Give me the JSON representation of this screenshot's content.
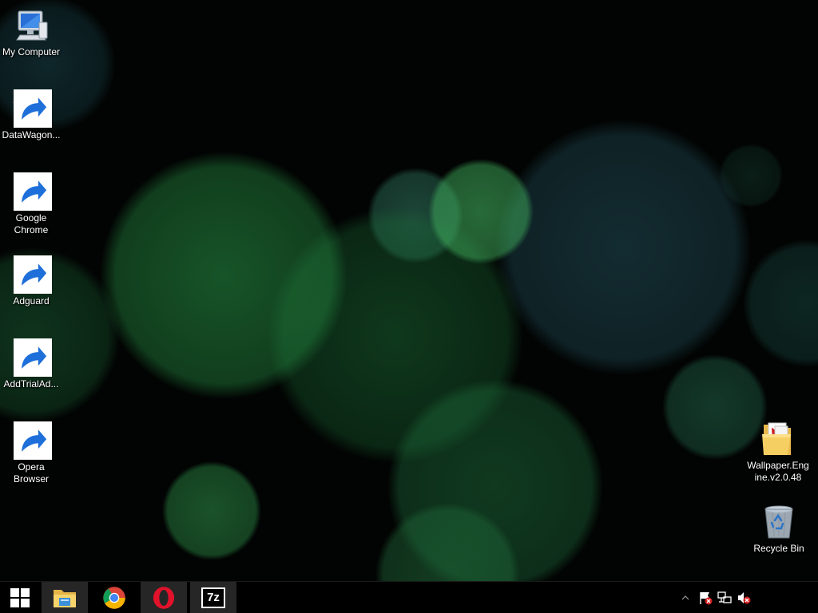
{
  "desktop": {
    "icons": [
      {
        "label": "My Computer",
        "icon": "computer-icon",
        "shortcut": false
      },
      {
        "label": "DataWagon...",
        "icon": "datawagon-icon",
        "shortcut": true
      },
      {
        "label": "Google Chrome",
        "icon": "chrome-icon",
        "shortcut": true
      },
      {
        "label": "Adguard",
        "icon": "adguard-icon",
        "shortcut": true
      },
      {
        "label": "AddTrialAd...",
        "icon": "adguard-admin-icon",
        "shortcut": true
      },
      {
        "label": "Opera Browser",
        "icon": "opera-icon",
        "shortcut": true
      },
      {
        "label": "Wallpaper.Engine.v2.0.48",
        "icon": "folder-icon",
        "shortcut": false
      },
      {
        "label": "Recycle Bin",
        "icon": "recycle-bin-icon",
        "shortcut": false
      }
    ]
  },
  "taskbar": {
    "start": {
      "icon": "windows-logo-icon"
    },
    "pinned": [
      {
        "name": "File Explorer",
        "icon": "file-explorer-icon",
        "active": true
      },
      {
        "name": "Google Chrome",
        "icon": "chrome-icon",
        "active": false
      },
      {
        "name": "Opera",
        "icon": "opera-icon",
        "active": true
      },
      {
        "name": "7-Zip",
        "icon": "7zip-icon",
        "label": "7z",
        "active": true
      }
    ],
    "tray": [
      {
        "icon": "chevron-up-icon"
      },
      {
        "icon": "action-center-flag-icon"
      },
      {
        "icon": "network-icon"
      },
      {
        "icon": "volume-muted-icon"
      }
    ]
  },
  "colors": {
    "taskbar_bg": "#000000",
    "active_btn_bg": "#262626",
    "chrome_red": "#db4437",
    "chrome_yellow": "#f4b400",
    "chrome_green": "#0f9d58",
    "chrome_blue": "#4285f4",
    "opera_red": "#e2122b",
    "adguard_green": "#68bc71"
  }
}
